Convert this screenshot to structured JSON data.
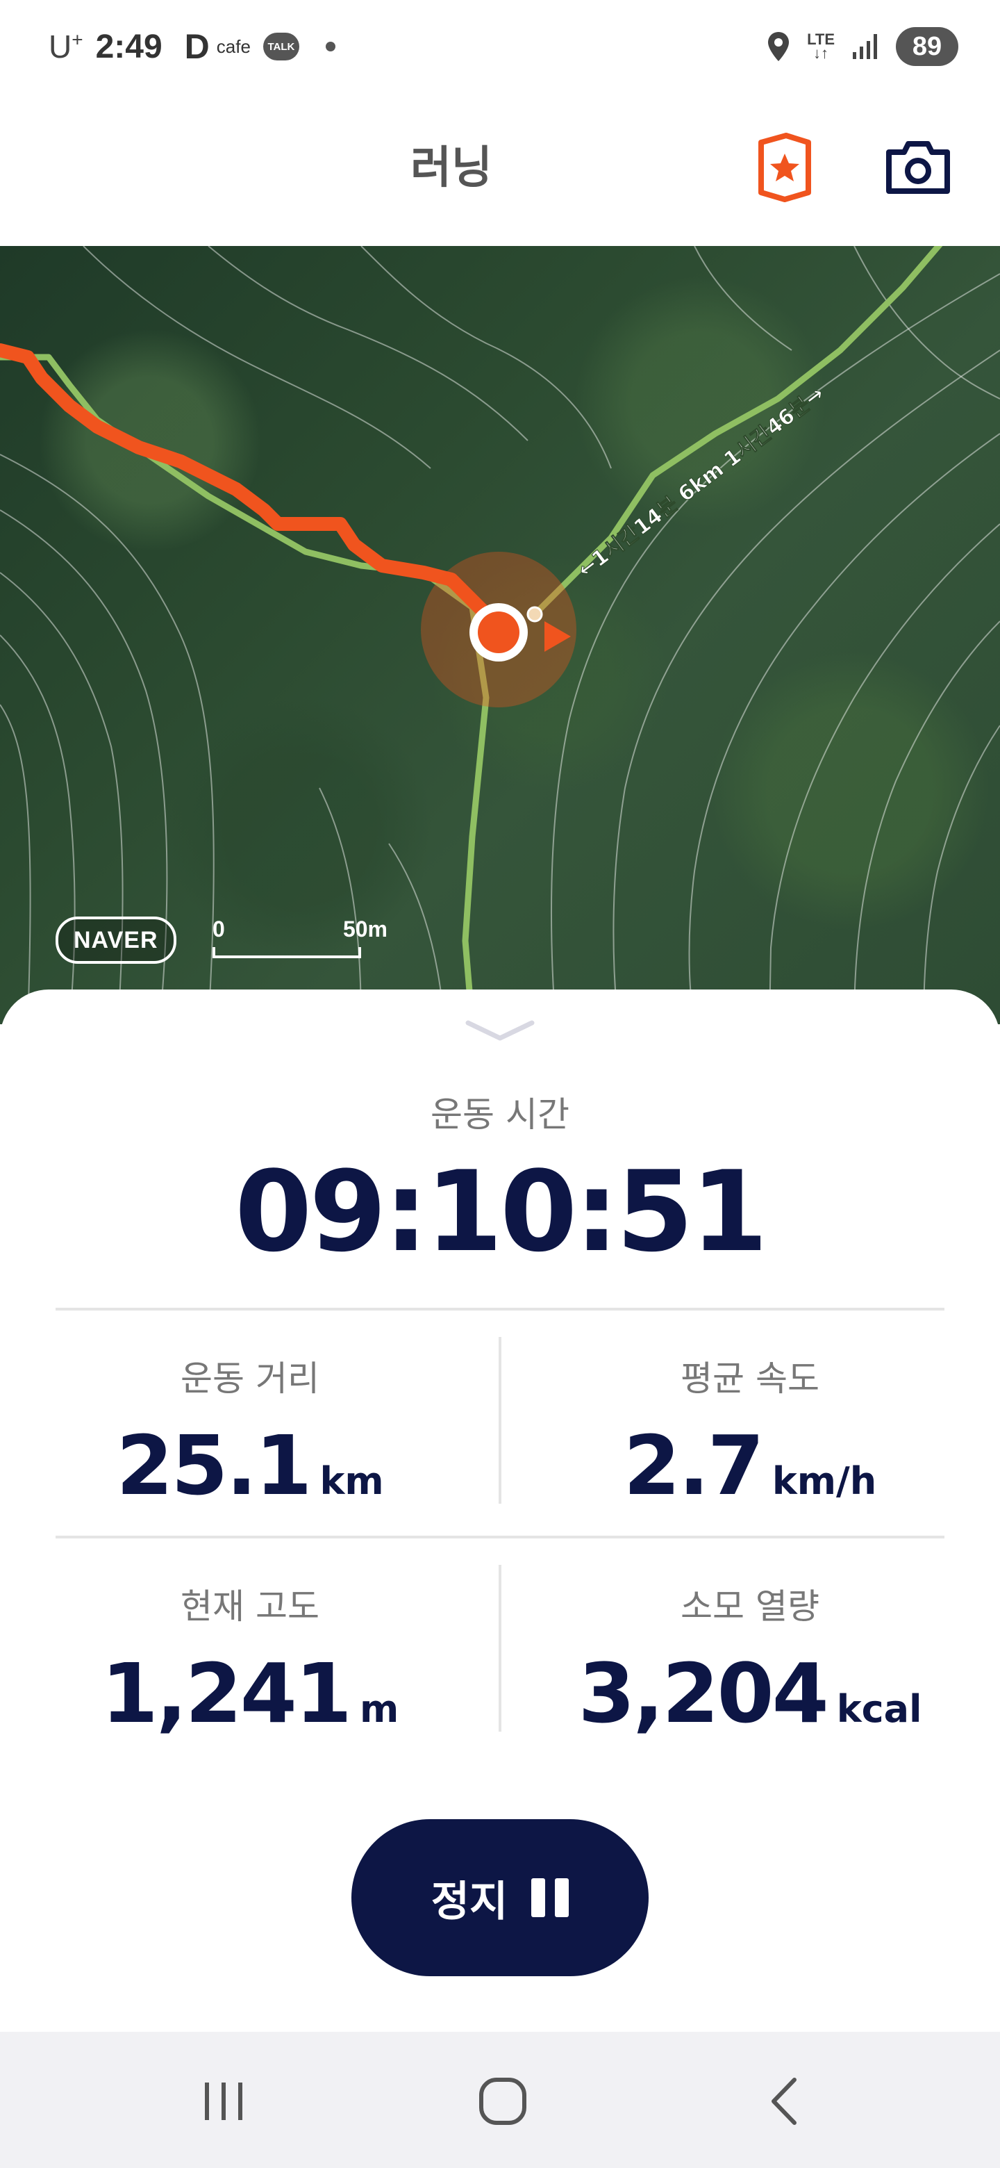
{
  "status_bar": {
    "carrier": "U",
    "carrier_sup": "+",
    "time": "2:49",
    "app_d": "D",
    "app_cafe": "cafe",
    "talk": "TALK",
    "network_top": "LTE",
    "network_bottom": "↓↑",
    "battery": "89",
    "icons": [
      "location-icon",
      "signal-icon"
    ]
  },
  "header": {
    "title": "러닝",
    "badge_icon": "star-badge-icon",
    "camera_icon": "camera-icon",
    "accent_color": "#f0541e"
  },
  "map": {
    "provider": "NAVER",
    "scale_zero": "0",
    "scale_max": "50m",
    "trail_label": "←1시간14분 6km 1시간46분→",
    "route_color": "#f0541e",
    "trail_color": "#8fbf62"
  },
  "stats": {
    "time_label": "운동 시간",
    "time_value": "09:10:51",
    "distance_label": "운동 거리",
    "distance_value": "25.1",
    "distance_unit": "km",
    "speed_label": "평균 속도",
    "speed_value": "2.7",
    "speed_unit": "km/h",
    "altitude_label": "현재 고도",
    "altitude_value": "1,241",
    "altitude_unit": "m",
    "calories_label": "소모 열량",
    "calories_value": "3,204",
    "calories_unit": "kcal"
  },
  "controls": {
    "stop_label": "정지",
    "primary_color": "#0d1645"
  },
  "nav_bar": {
    "items": [
      "recent-apps-icon",
      "home-icon",
      "back-icon"
    ]
  }
}
